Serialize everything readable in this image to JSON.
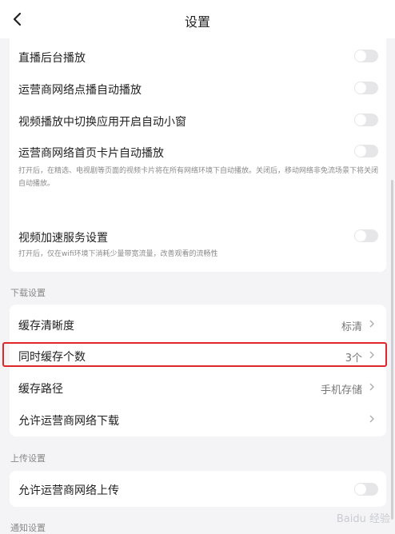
{
  "header": {
    "title": "设置"
  },
  "playback": {
    "items": [
      {
        "label": "直播后台播放"
      },
      {
        "label": "运营商网络点播自动播放"
      },
      {
        "label": "视频播放中切换应用开启自动小窗"
      },
      {
        "label": "运营商网络首页卡片自动播放",
        "desc": "打开后，在精选、电视剧等页面的视频卡片将在所有网络环境下自动播放。关闭后，移动网络非免流场景下将关闭自动播放。"
      }
    ],
    "accel": {
      "label": "视频加速服务设置",
      "desc": "打开后，仅在wifi环境下消耗少量带宽流量，改善观看的流畅性"
    }
  },
  "download": {
    "section_title": "下载设置",
    "items": [
      {
        "label": "缓存清晰度",
        "value": "标清"
      },
      {
        "label": "同时缓存个数",
        "value": "3个"
      },
      {
        "label": "缓存路径",
        "value": "手机存储"
      },
      {
        "label": "允许运营商网络下载",
        "value": ""
      }
    ]
  },
  "upload": {
    "section_title": "上传设置",
    "items": [
      {
        "label": "允许运营商网络上传"
      }
    ]
  },
  "notify": {
    "section_title": "通知设置"
  },
  "watermark": "Baidu 经验",
  "colors": {
    "highlight": "#e0262a",
    "toggle_off": "#e6e6e9"
  }
}
